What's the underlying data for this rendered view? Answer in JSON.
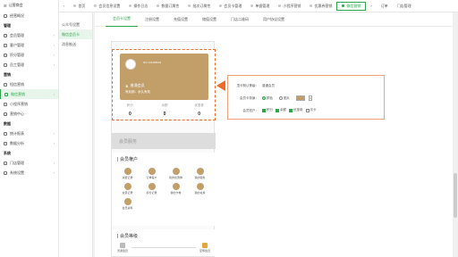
{
  "sidebar": {
    "header": "让营商会",
    "groups": [
      {
        "type": "item",
        "label": "经营概况",
        "arrow": false,
        "active": false
      },
      {
        "type": "section",
        "label": "管理"
      },
      {
        "type": "item",
        "label": "会员管理",
        "arrow": true,
        "active": false
      },
      {
        "type": "item",
        "label": "客户管理",
        "arrow": true,
        "active": false
      },
      {
        "type": "item",
        "label": "积分管理",
        "arrow": true,
        "active": false
      },
      {
        "type": "item",
        "label": "员工管理",
        "arrow": true,
        "active": false
      },
      {
        "type": "section",
        "label": "营销"
      },
      {
        "type": "item",
        "label": "短信营销",
        "arrow": false,
        "active": false
      },
      {
        "type": "item",
        "label": "微信营销",
        "arrow": true,
        "active": true
      },
      {
        "type": "item",
        "label": "小程序营销",
        "arrow": false,
        "active": false
      },
      {
        "type": "item",
        "label": "营销中心",
        "arrow": false,
        "active": false
      },
      {
        "type": "section",
        "label": "数据"
      },
      {
        "type": "item",
        "label": "统计报表",
        "arrow": true,
        "active": false
      },
      {
        "type": "item",
        "label": "数据分析",
        "arrow": true,
        "active": false
      },
      {
        "type": "section",
        "label": "系统"
      },
      {
        "type": "item",
        "label": "门店管理",
        "arrow": true,
        "active": false
      },
      {
        "type": "item",
        "label": "系统设置",
        "arrow": true,
        "active": false
      }
    ]
  },
  "topbar": {
    "tabs": [
      "首页",
      "会员信息设置",
      "操作日志",
      "数据订属性",
      "批次订属性",
      "会员卡管理",
      "单据管理",
      "小程序营销",
      "优惠券营销",
      "微信营销"
    ],
    "active_index": 9,
    "right": [
      "订单",
      "门店管理"
    ]
  },
  "subnav": {
    "items": [
      "公众号设置",
      "微信会员卡",
      "消息推送"
    ],
    "active_index": 1
  },
  "main_tabs": {
    "items": [
      "会员卡设置",
      "注册设置",
      "充值设置",
      "储值设置",
      "门店二维码",
      "用户协议设置"
    ],
    "active_index": 0
  },
  "preview": {
    "card_number": "NO.131268001",
    "level_name": "普通会员",
    "validity": "有效期：永久有效",
    "stats": [
      {
        "label": "积分",
        "value": "0"
      },
      {
        "label": "余额",
        "value": "0"
      },
      {
        "label": "优惠券",
        "value": "0"
      }
    ],
    "services_label": "会员服务",
    "rights_title": "会员権户",
    "rights_items": [
      "消费记录",
      "订单客户",
      "我的优惠券",
      "我的服务",
      "充值记录",
      "积分记录",
      "我的卡券",
      "我的兑换",
      "会员资料"
    ],
    "levels_title": "会员等级",
    "levels": [
      {
        "label": "普通会员"
      },
      {
        "label": "至尊会员"
      }
    ]
  },
  "settings_panel": {
    "title_label": "顶卡默认等级：",
    "title_value": "普通会员",
    "bg_label": "会员卡背景：",
    "bg_options": [
      "颜色",
      "图片"
    ],
    "bg_selected": 0,
    "bg_color": "#c29e69",
    "fields_label": "会员权户：",
    "fields": [
      {
        "label": "积分",
        "checked": true
      },
      {
        "label": "余额",
        "checked": true
      },
      {
        "label": "优惠券",
        "checked": true
      },
      {
        "label": "次卡",
        "checked": false
      }
    ]
  },
  "colors": {
    "accent": "#2ea44f",
    "card": "#c29e69",
    "highlight": "#f06a2a"
  }
}
